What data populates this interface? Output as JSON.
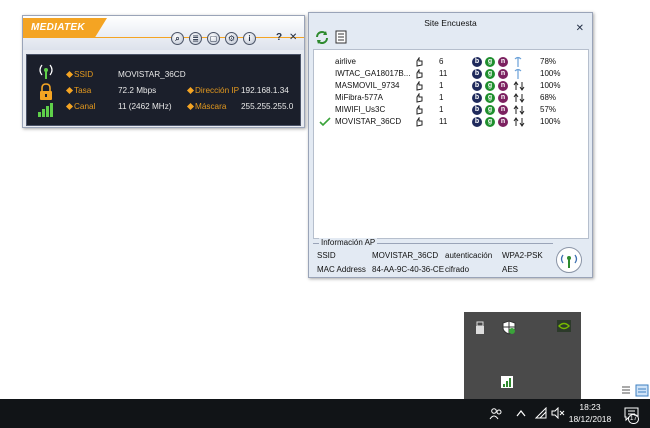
{
  "mediatek": {
    "logo": "MEDIATEK",
    "buttons": {
      "search": "⌕",
      "list": "≣",
      "doc": "▢",
      "settings": "⚙",
      "info": "i"
    },
    "help": "?",
    "close": "✕",
    "ssid_label": "SSID",
    "ssid_value": "MOVISTAR_36CD",
    "rate_label": "Tasa",
    "rate_value": "72.2 Mbps",
    "ip_label": "Dirección IP",
    "ip_value": "192.168.1.34",
    "channel_label": "Canal",
    "channel_value": "11 (2462 MHz)",
    "mask_label": "Máscara",
    "mask_value": "255.255.255.0",
    "accent": "#f4a423"
  },
  "site_survey": {
    "title": "Site Encuesta",
    "close": "✕",
    "networks": [
      {
        "ssid": "airlive",
        "channel": "6",
        "b": "b",
        "g": "g",
        "n": "n",
        "signal": "78%",
        "connected": false
      },
      {
        "ssid": "IWTAC_GA18017B...",
        "channel": "11",
        "b": "b",
        "g": "g",
        "n": "n",
        "signal": "100%",
        "connected": false
      },
      {
        "ssid": "MASMOVIL_9734",
        "channel": "1",
        "b": "b",
        "g": "g",
        "n": "n",
        "signal": "100%",
        "connected": false
      },
      {
        "ssid": "MiFibra-577A",
        "channel": "1",
        "b": "b",
        "g": "g",
        "n": "n",
        "signal": "68%",
        "connected": false
      },
      {
        "ssid": "MIWIFI_Us3C",
        "channel": "1",
        "b": "b",
        "g": "g",
        "n": "n",
        "signal": "57%",
        "connected": false
      },
      {
        "ssid": "MOVISTAR_36CD",
        "channel": "11",
        "b": "b",
        "g": "g",
        "n": "n",
        "signal": "100%",
        "connected": true
      }
    ],
    "ap_info": {
      "legend": "Información AP",
      "ssid_label": "SSID",
      "ssid_value": "MOVISTAR_36CD",
      "auth_label": "autenticación",
      "auth_value": "WPA2-PSK",
      "mac_label": "MAC Address",
      "mac_value": "84-AA-9C-40-36-CE",
      "cipher_label": "cifrado",
      "cipher_value": "AES"
    }
  },
  "taskbar": {
    "time": "18:23",
    "date": "18/12/2018",
    "notifications": "17"
  }
}
